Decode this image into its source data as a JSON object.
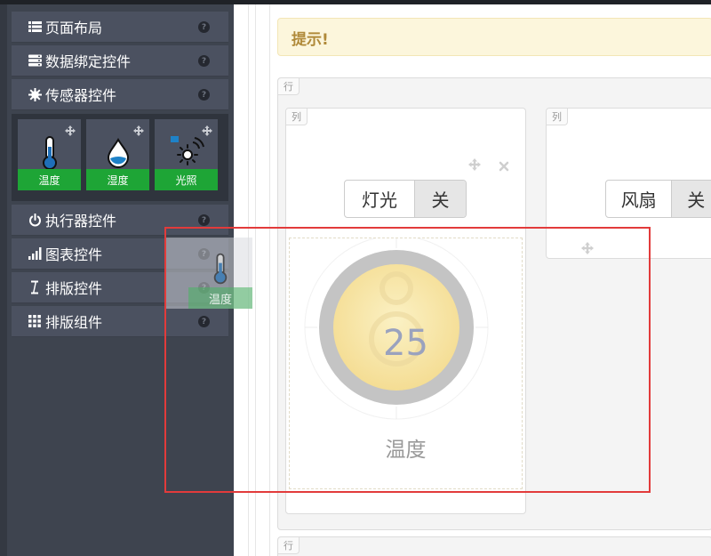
{
  "sidebar": {
    "items": [
      {
        "label": "页面布局",
        "icon": "list-icon"
      },
      {
        "label": "数据绑定控件",
        "icon": "database-icon"
      },
      {
        "label": "传感器控件",
        "icon": "gear-icon"
      },
      {
        "label": "执行器控件",
        "icon": "power-icon"
      },
      {
        "label": "图表控件",
        "icon": "bar-chart-icon"
      },
      {
        "label": "排版控件",
        "icon": "text-cursor-icon"
      },
      {
        "label": "排版组件",
        "icon": "grid-icon"
      }
    ],
    "help_glyph": "?",
    "sensors": [
      {
        "label": "温度",
        "icon": "thermometer-icon"
      },
      {
        "label": "湿度",
        "icon": "droplet-icon"
      },
      {
        "label": "光照",
        "icon": "light-sensor-icon"
      }
    ]
  },
  "workspace": {
    "tip": "提示!",
    "row_tag": "行",
    "col_tag": "列",
    "light_switch": {
      "label": "灯光",
      "value": "关"
    },
    "fan_switch": {
      "label": "风扇",
      "value": "关"
    },
    "gauge": {
      "value": "25",
      "label": "温度",
      "fill_color": "#f6e4a0",
      "ring_color": "#c4c4c4"
    }
  },
  "drag": {
    "label": "温度"
  },
  "colors": {
    "sidebar": "#3e444f",
    "accent": "#1ea536",
    "highlight": "#e23b3b",
    "tip_bg": "#fcf6dc",
    "tip_text": "#b08a3a"
  }
}
